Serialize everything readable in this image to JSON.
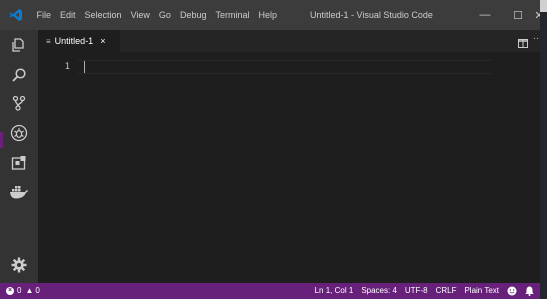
{
  "window": {
    "title": "Untitled-1 - Visual Studio Code",
    "minimize": "—",
    "maximize": "☐",
    "close": "✕"
  },
  "menu": {
    "items": [
      "File",
      "Edit",
      "Selection",
      "View",
      "Go",
      "Debug",
      "Terminal",
      "Help"
    ]
  },
  "activitybar": {
    "icons": [
      "explorer-icon",
      "search-icon",
      "source-control-icon",
      "debug-icon",
      "extensions-icon",
      "docker-icon",
      "settings-gear-icon"
    ]
  },
  "tabs": [
    {
      "label": "Untitled-1",
      "close": "×",
      "icon": "≡"
    }
  ],
  "editor_actions": {
    "more": "···"
  },
  "editor": {
    "line_number": "1"
  },
  "statusbar": {
    "errors": "0",
    "warnings": "0",
    "position": "Ln 1, Col 1",
    "spaces": "Spaces: 4",
    "encoding": "UTF-8",
    "eol": "CRLF",
    "language": "Plain Text"
  },
  "colors": {
    "statusbar": "#68217a",
    "titlebar": "#3c3c3c",
    "activitybar": "#333333",
    "editor": "#1e1e1e",
    "vscode_blue": "#0e7acc"
  }
}
